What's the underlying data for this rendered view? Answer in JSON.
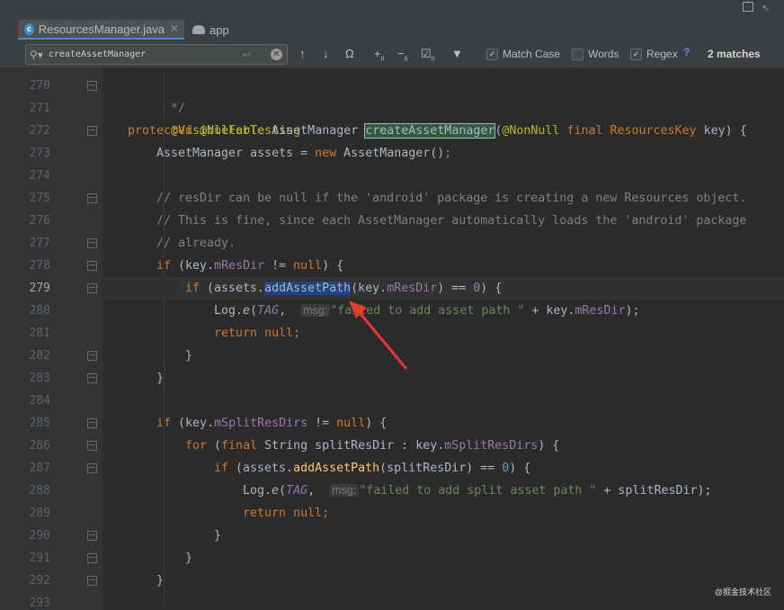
{
  "tabs": [
    {
      "label": "ResourcesManager.java",
      "icon": "java-class-icon",
      "active": true
    },
    {
      "label": "app",
      "icon": "android-icon",
      "active": false
    }
  ],
  "search": {
    "query": "createAssetManager",
    "match_case_label": "Match Case",
    "match_case_checked": true,
    "words_label": "Words",
    "words_checked": false,
    "regex_label": "Regex",
    "regex_checked": true,
    "help_label": "?",
    "matches_text": "2 matches"
  },
  "line_numbers": [
    "270",
    "271",
    "272",
    "273",
    "274",
    "275",
    "276",
    "277",
    "278",
    "279",
    "280",
    "281",
    "282",
    "283",
    "284",
    "285",
    "286",
    "287",
    "288",
    "289",
    "290",
    "291",
    "292",
    "293"
  ],
  "current_line": "279",
  "code": {
    "l270": "*/",
    "l271_ann": "@VisibleForTesting",
    "l272": {
      "kw1": "protected",
      "ann": "@Nullable",
      "type": "AssetManager",
      "method": "createAssetManager",
      "paren": "(",
      "ann2": "@NonNull",
      "kw2": "final",
      "ptype": "ResourcesKey",
      "rest": "key) {"
    },
    "l273": {
      "a": "AssetManager assets = ",
      "kw": "new",
      "b": "AssetManager()",
      "semi": ";"
    },
    "l275": "// resDir can be null if the 'android' package is creating a new Resources object.",
    "l276": "// This is fine, since each AssetManager automatically loads the 'android' package",
    "l277": "// already.",
    "l278": {
      "kw": "if",
      "a": " (key.",
      "fld": "mResDir",
      "b": " != ",
      "kw2": "null",
      "c": ") {"
    },
    "l279": {
      "kw": "if",
      "a": " (assets.",
      "method": "addAssetPath",
      "b": "(key.",
      "fld": "mResDir",
      "c": ") == ",
      "num": "0",
      "d": ") {"
    },
    "l280": {
      "a": "Log.",
      "method": "e",
      "b": "(",
      "tag": "TAG",
      "c": ", ",
      "hint": "msg:",
      "str": "\"failed to add asset path \"",
      "d": " + key.",
      "fld": "mResDir",
      "e": ");"
    },
    "l281": {
      "kw": "return",
      "kw2": "null",
      "semi": ";"
    },
    "l282": "}",
    "l283": "}",
    "l285": {
      "kw": "if",
      "a": " (key.",
      "fld": "mSplitResDirs",
      "b": " != ",
      "kw2": "null",
      "c": ") {"
    },
    "l286": {
      "kw": "for",
      "a": " (",
      "kw2": "final",
      "b": " String splitResDir : key.",
      "fld": "mSplitResDirs",
      "c": ") {"
    },
    "l287": {
      "kw": "if",
      "a": " (assets.",
      "method": "addAssetPath",
      "b": "(splitResDir) == ",
      "num": "0",
      "c": ") {"
    },
    "l288": {
      "a": "Log.",
      "method": "e",
      "b": "(",
      "tag": "TAG",
      "c": ", ",
      "hint": "msg:",
      "str": "\"failed to add split asset path \"",
      "d": " + splitResDir);"
    },
    "l289": {
      "kw": "return",
      "kw2": "null",
      "semi": ";"
    },
    "l290": "}",
    "l291": "}",
    "l292": "}"
  },
  "watermark": "@掘金技术社区",
  "colors": {
    "editor_bg": "#2b2b2b",
    "keyword": "#cc7832",
    "annotation": "#bbb529",
    "comment": "#808080",
    "field": "#9876aa",
    "number": "#6897bb",
    "string": "#6a8759",
    "arrow": "#e8392f"
  }
}
